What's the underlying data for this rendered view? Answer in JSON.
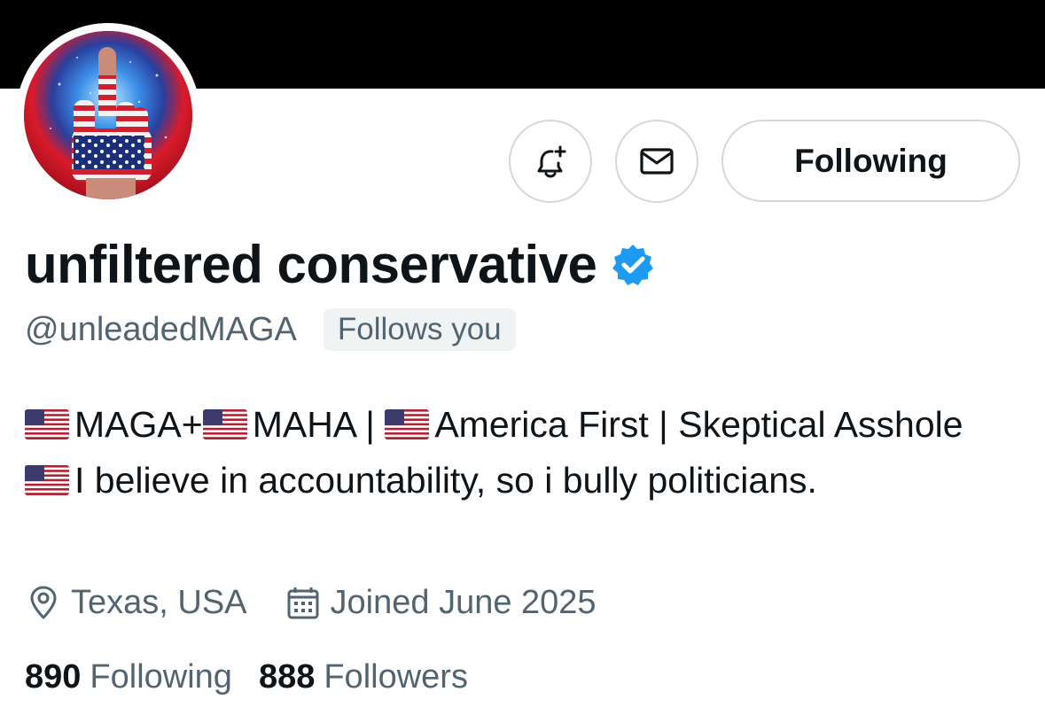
{
  "profile": {
    "display_name": "unfiltered conservative",
    "handle": "@unleadedMAGA",
    "follows_you_badge": "Follows you",
    "verified_icon": "verified-badge-icon",
    "avatar_icon": "middle-finger-flag-avatar",
    "bio": {
      "segment1": "MAGA+",
      "segment2": "MAHA | ",
      "segment3": "America First | Skeptical Asshole ",
      "segment4": "I believe in accountability, so i bully politicians."
    },
    "location": "Texas, USA",
    "location_icon": "location-pin-icon",
    "joined": "Joined June 2025",
    "joined_icon": "calendar-icon",
    "stats": {
      "following_count": "890",
      "following_label": "Following",
      "followers_count": "888",
      "followers_label": "Followers"
    }
  },
  "actions": {
    "notify_icon": "bell-plus-icon",
    "message_icon": "envelope-icon",
    "follow_label": "Following"
  },
  "colors": {
    "text_primary": "#0f1419",
    "text_secondary": "#536471",
    "verified_blue": "#1d9bf0",
    "button_border": "#cfd9de",
    "badge_bg": "#eff3f4",
    "banner": "#000000"
  }
}
